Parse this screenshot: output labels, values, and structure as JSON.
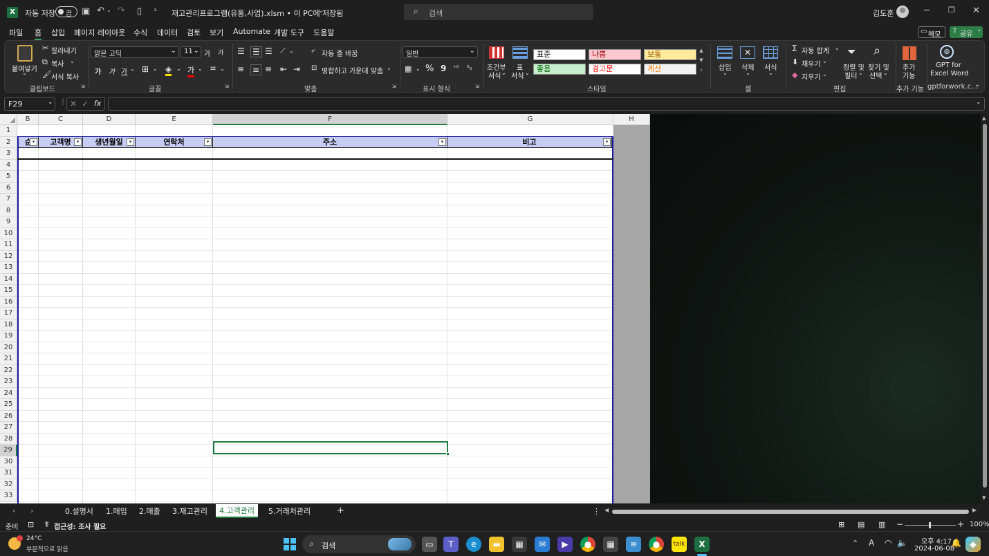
{
  "titlebar": {
    "autosave_label": "자동 저장",
    "autosave_state": "끔",
    "filename": "재고관리프로그램(유통,사업).xlsm • 이 PC에 저장됨",
    "search_placeholder": "검색",
    "user_name": "김도훈"
  },
  "menu": {
    "items": [
      "파일",
      "홈",
      "삽입",
      "페이지 레이아웃",
      "수식",
      "데이터",
      "검토",
      "보기",
      "Automate",
      "개발 도구",
      "도움말"
    ],
    "memo": "메모",
    "share": "공유"
  },
  "ribbon": {
    "clipboard": {
      "paste": "붙여넣기",
      "cut": "잘라내기",
      "copy": "복사",
      "format_painter": "서식 복사",
      "label": "클립보드"
    },
    "font": {
      "name": "맑은 고딕",
      "size": "11",
      "label": "글꼴",
      "grow": "가",
      "shrink": "가",
      "bold": "가",
      "italic": "가",
      "underline": "가"
    },
    "alignment": {
      "wrap": "자동 줄 바꿈",
      "merge": "병합하고 가운데 맞춤",
      "label": "맞춤"
    },
    "number": {
      "format": "일반",
      "label": "표시 형식"
    },
    "styles": {
      "conditional": "조건부",
      "conditional2": "서식",
      "table": "표",
      "table2": "서식",
      "cells": [
        {
          "text": "표준",
          "bg": "#ffffff",
          "fg": "#000000"
        },
        {
          "text": "나쁨",
          "bg": "#ffc7ce",
          "fg": "#9c0006"
        },
        {
          "text": "보통",
          "bg": "#ffeb9c",
          "fg": "#9c5700"
        },
        {
          "text": "좋음",
          "bg": "#c6efce",
          "fg": "#006100"
        },
        {
          "text": "경고문",
          "bg": "#ffffff",
          "fg": "#ff0000"
        },
        {
          "text": "계산",
          "bg": "#f2f2f2",
          "fg": "#fa7d00"
        }
      ],
      "label": "스타일"
    },
    "cells": {
      "insert": "삽입",
      "delete": "삭제",
      "format": "서식",
      "label": "셀"
    },
    "editing": {
      "autosum": "자동 합계",
      "fill": "채우기",
      "clear": "지우기",
      "sort": "정렬 및",
      "sort2": "필터",
      "find": "찾기 및",
      "find2": "선택",
      "label": "편집"
    },
    "addins": {
      "addins": "추가",
      "addins2": "기능",
      "label": "추가 기능"
    },
    "gpt": {
      "line1": "GPT for",
      "line2": "Excel Word",
      "label": "gptforwork.c..."
    }
  },
  "formula": {
    "namebox": "F29",
    "fx": "fx"
  },
  "grid": {
    "columns": [
      "B",
      "C",
      "D",
      "E",
      "F",
      "G",
      "H"
    ],
    "rows": [
      "1",
      "2",
      "3",
      "4",
      "5",
      "6",
      "7",
      "8",
      "9",
      "10",
      "11",
      "12",
      "13",
      "14",
      "15",
      "16",
      "17",
      "18",
      "19",
      "20",
      "21",
      "22",
      "23",
      "24",
      "25",
      "26",
      "27",
      "28",
      "29",
      "30",
      "31",
      "32",
      "33"
    ],
    "table_headers": [
      "순번",
      "고객명",
      "생년월일",
      "연락처",
      "주소",
      "비고"
    ]
  },
  "sheets": {
    "tabs": [
      "0.설명서",
      "1.매입",
      "2.매출",
      "3.재고관리",
      "4.고객관리",
      "5.거래처관리"
    ],
    "active": "4.고객관리"
  },
  "status": {
    "ready": "준비",
    "accessibility": "접근성: 조사 필요",
    "zoom": "100%"
  },
  "taskbar": {
    "weather_temp": "24°C",
    "weather_desc": "부분적으로 맑음",
    "search": "검색",
    "time": "오후 4:17",
    "date": "2024-06-08"
  }
}
